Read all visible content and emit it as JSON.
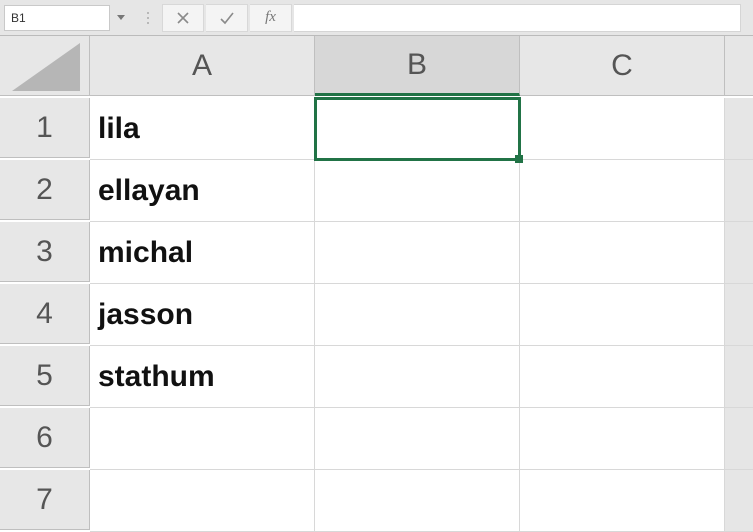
{
  "formula_bar": {
    "name_box_value": "B1",
    "cancel_label": "✕",
    "accept_label": "✓",
    "fx_label": "fx",
    "formula_value": ""
  },
  "sheet": {
    "columns": [
      "A",
      "B",
      "C"
    ],
    "selected_column_index": 1,
    "selected_cell": "B1",
    "rows": [
      {
        "num": "1",
        "cells": [
          "lila",
          "",
          ""
        ]
      },
      {
        "num": "2",
        "cells": [
          "ellayan",
          "",
          ""
        ]
      },
      {
        "num": "3",
        "cells": [
          "michal",
          "",
          ""
        ]
      },
      {
        "num": "4",
        "cells": [
          "jasson",
          "",
          ""
        ]
      },
      {
        "num": "5",
        "cells": [
          "stathum",
          "",
          ""
        ]
      },
      {
        "num": "6",
        "cells": [
          "",
          "",
          ""
        ]
      },
      {
        "num": "7",
        "cells": [
          "",
          "",
          ""
        ]
      }
    ]
  }
}
